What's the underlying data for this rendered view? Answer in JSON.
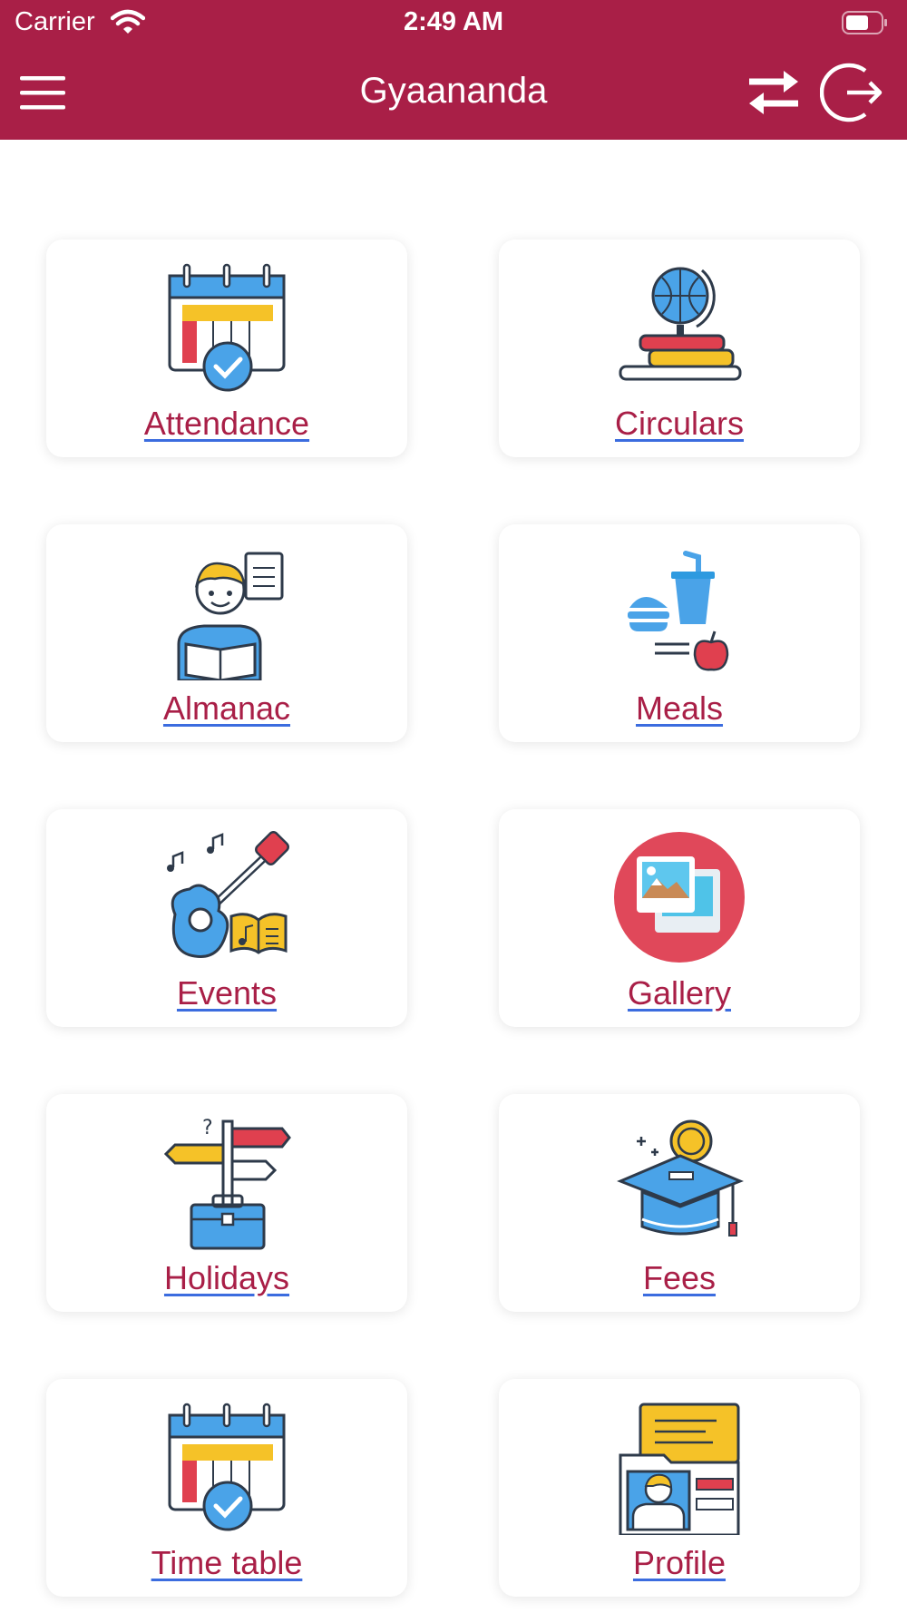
{
  "status_bar": {
    "carrier": "Carrier",
    "time": "2:49 AM"
  },
  "header": {
    "title": "Gyaananda"
  },
  "colors": {
    "brand": "#a91f47",
    "link_underline": "#3b6cdf",
    "blue": "#4aa3e8",
    "yellow": "#f5c228",
    "red": "#e0404f"
  },
  "tiles": [
    {
      "label": "Attendance",
      "icon": "calendar-check-icon"
    },
    {
      "label": "Circulars",
      "icon": "globe-books-icon"
    },
    {
      "label": "Almanac",
      "icon": "reader-icon"
    },
    {
      "label": "Meals",
      "icon": "meal-icon"
    },
    {
      "label": "Events",
      "icon": "guitar-icon"
    },
    {
      "label": "Gallery",
      "icon": "photos-icon"
    },
    {
      "label": "Holidays",
      "icon": "signpost-briefcase-icon"
    },
    {
      "label": "Fees",
      "icon": "graduation-coin-icon"
    },
    {
      "label": "Time table",
      "icon": "calendar-check-icon"
    },
    {
      "label": "Profile",
      "icon": "id-card-icon"
    }
  ]
}
